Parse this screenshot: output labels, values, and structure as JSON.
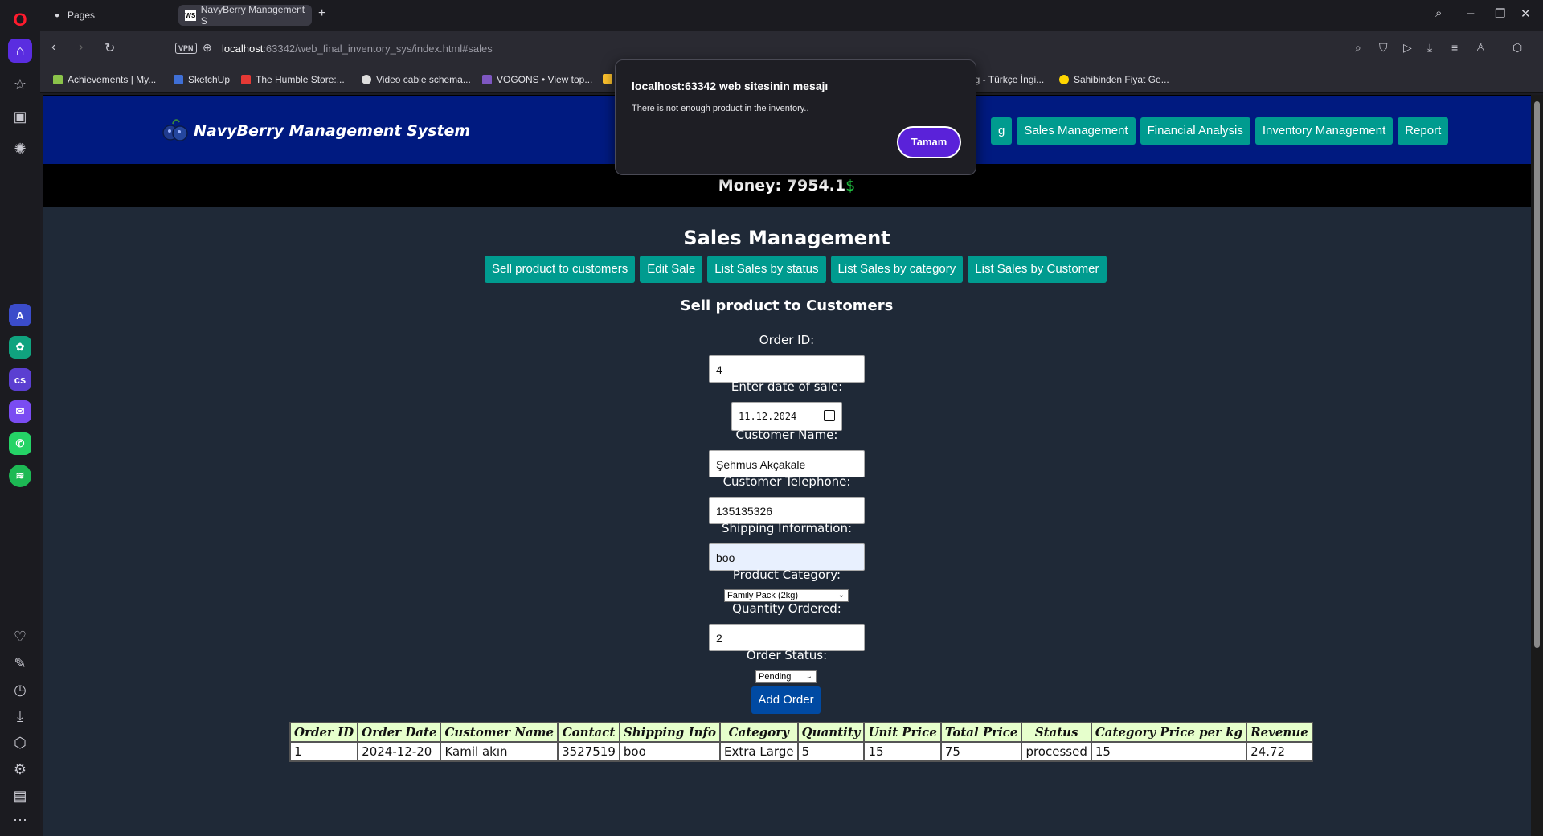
{
  "browser": {
    "tabs": [
      {
        "title": "Pages",
        "icon": "github-icon"
      },
      {
        "title": "NavyBerry Management S",
        "icon": "webstorm-icon",
        "favicon_text": "WS"
      }
    ],
    "url_host": "localhost",
    "url_rest": ":63342/web_final_inventory_sys/index.html#sales",
    "vpn_label": "VPN",
    "bookmarks": [
      "Achievements | My...",
      "SketchUp",
      "The Humble Store:...",
      "Video cable schema...",
      "VOGONS • View top...",
      "ng - Türkçe İngi...",
      "Sahibinden Fiyat Ge..."
    ]
  },
  "page": {
    "brand": "NavyBerry Management System",
    "nav": [
      "g",
      "Sales Management",
      "Financial Analysis",
      "Inventory Management",
      "Report"
    ],
    "money_label": "Money: 7954.1",
    "money_symbol": "$",
    "section_title": "Sales Management",
    "sub_tabs": [
      "Sell product to customers",
      "Edit Sale",
      "List Sales by status",
      "List Sales by category",
      "List Sales by Customer"
    ],
    "form_title": "Sell product to Customers",
    "form": {
      "order_id_label": "Order ID:",
      "order_id_value": "4",
      "date_label": "Enter date of sale:",
      "date_value": "11.12.2024",
      "customer_name_label": "Customer Name:",
      "customer_name_value": "Şehmus Akçakale",
      "telephone_label": "Customer Telephone:",
      "telephone_value": "135135326",
      "shipping_label": "Shipping Information:",
      "shipping_value": "boo",
      "category_label": "Product Category:",
      "category_value": "Family Pack (2kg)",
      "quantity_label": "Quantity Ordered:",
      "quantity_value": "2",
      "status_label": "Order Status:",
      "status_value": "Pending",
      "submit_label": "Add Order"
    },
    "table": {
      "headers": [
        "Order ID",
        "Order Date",
        "Customer Name",
        "Contact",
        "Shipping Info",
        "Category",
        "Quantity",
        "Unit Price",
        "Total Price",
        "Status",
        "Category Price per kg",
        "Revenue"
      ],
      "rows": [
        [
          "1",
          "2024-12-20",
          "Kamil akın",
          "3527519",
          "boo",
          "Extra Large",
          "5",
          "15",
          "75",
          "processed",
          "15",
          "24.72"
        ]
      ]
    }
  },
  "dialog": {
    "title": "localhost:63342 web sitesinin mesajı",
    "message": "There is not enough product in the inventory..",
    "ok_label": "Tamam"
  },
  "colors": {
    "header_bg": "#001a80",
    "teal_button": "#009b8f",
    "main_bg": "#1f2937",
    "add_button": "#004aa3",
    "dialog_button": "#5a22d9",
    "table_header_bg": "#e6ffcc"
  }
}
